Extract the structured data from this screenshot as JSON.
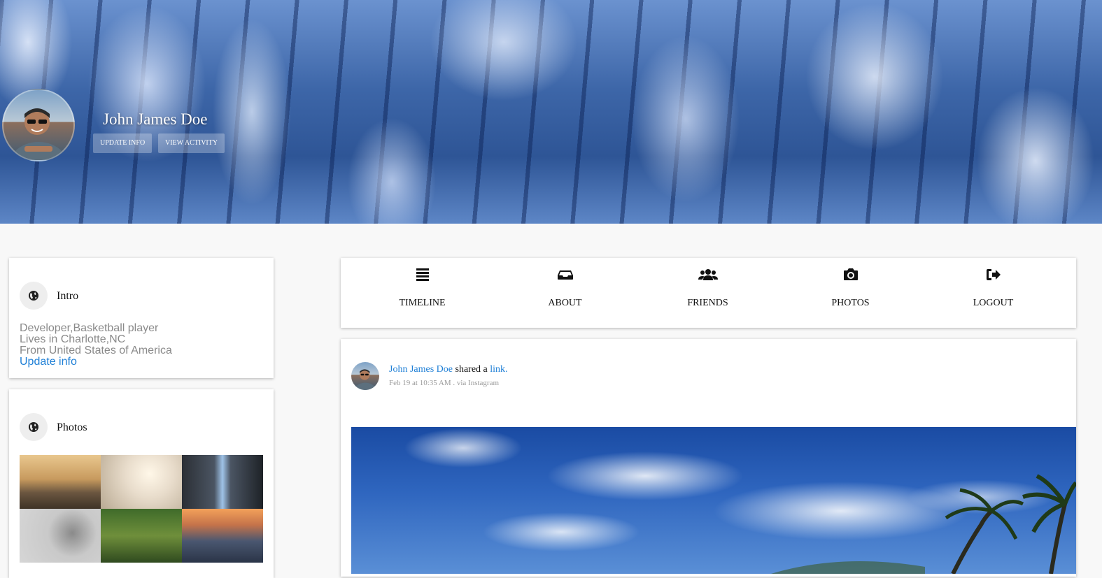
{
  "profile": {
    "name": "John James Doe",
    "update_info_label": "UPDATE INFO",
    "view_activity_label": "VIEW ACTIVITY"
  },
  "intro": {
    "title": "Intro",
    "occupation": "Developer,Basketball player",
    "lives_in": "Lives in Charlotte,NC",
    "from": "From United States of America",
    "update_link": "Update info"
  },
  "photos": {
    "title": "Photos",
    "items": [
      "photo-friends-sunset",
      "photo-superhero-kid",
      "photo-waterfall",
      "photo-man-banana",
      "photo-forest-tree",
      "photo-city-sunset"
    ]
  },
  "nav": {
    "items": [
      {
        "label": "TIMELINE",
        "icon": "list-icon"
      },
      {
        "label": "ABOUT",
        "icon": "inbox-icon"
      },
      {
        "label": "FRIENDS",
        "icon": "users-icon"
      },
      {
        "label": "PHOTOS",
        "icon": "camera-icon"
      },
      {
        "label": "LOGOUT",
        "icon": "sign-out-icon"
      }
    ]
  },
  "post": {
    "author": "John James Doe",
    "action": " shared a ",
    "object_link": "link.",
    "meta": "Feb 19 at 10:35 AM . via Instagram"
  },
  "colors": {
    "link": "#1e7fd6",
    "page_bg": "#f8f8f8",
    "muted_text": "#8a8a8a"
  }
}
